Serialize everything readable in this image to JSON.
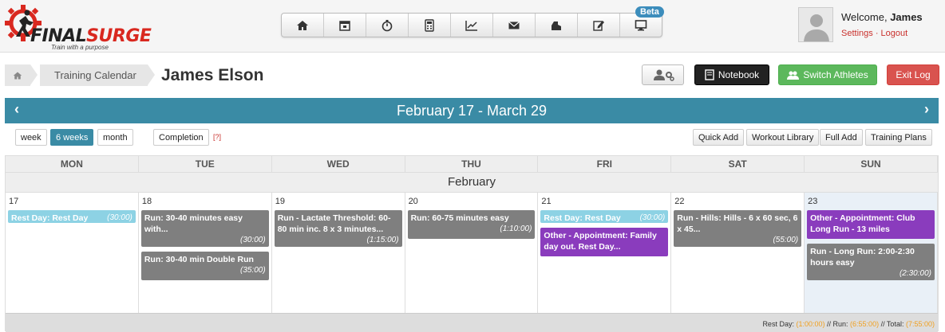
{
  "brand": {
    "logo_a": "FINAL",
    "logo_b": "SURGE",
    "tagline": "Train with a purpose"
  },
  "nav": {
    "items": [
      {
        "icon": "home-icon"
      },
      {
        "icon": "calendar-icon"
      },
      {
        "icon": "stopwatch-icon"
      },
      {
        "icon": "calculator-icon"
      },
      {
        "icon": "chart-icon"
      },
      {
        "icon": "mail-icon"
      },
      {
        "icon": "shoe-icon"
      },
      {
        "icon": "edit-icon"
      },
      {
        "icon": "monitor-icon"
      }
    ],
    "beta_badge": "Beta"
  },
  "user": {
    "welcome_prefix": "Welcome,",
    "name": "James",
    "settings": "Settings",
    "separator": "·",
    "logout": "Logout"
  },
  "breadcrumb": {
    "calendar": "Training Calendar"
  },
  "page_title": "James Elson",
  "actions": {
    "notebook": "Notebook",
    "switch_athletes": "Switch Athletes",
    "exit_log": "Exit Log"
  },
  "calendar": {
    "range": "February 17 - March 29",
    "prev": "‹",
    "next": "›",
    "views": {
      "week": "week",
      "six_weeks": "6 weeks",
      "month": "month"
    },
    "completion": "Completion",
    "help": "[?]",
    "tools": {
      "quick_add": "Quick Add",
      "workout_library": "Workout Library",
      "full_add": "Full Add",
      "training_plans": "Training Plans"
    },
    "day_headers": [
      "MON",
      "TUE",
      "WED",
      "THU",
      "FRI",
      "SAT",
      "SUN"
    ],
    "month_label": "February",
    "days": [
      {
        "num": "17",
        "events": [
          {
            "type": "rest",
            "title": "Rest Day: Rest Day",
            "duration": "(30:00)"
          }
        ]
      },
      {
        "num": "18",
        "events": [
          {
            "type": "run",
            "title": "Run: 30-40 minutes easy with...",
            "duration": "(30:00)"
          },
          {
            "type": "run",
            "title": "Run: 30-40 min Double Run",
            "duration": "(35:00)"
          }
        ]
      },
      {
        "num": "19",
        "events": [
          {
            "type": "run",
            "title": "Run - Lactate Threshold: 60-80 min inc. 8 x 3 minutes...",
            "duration": "(1:15:00)"
          }
        ]
      },
      {
        "num": "20",
        "events": [
          {
            "type": "run",
            "title": "Run: 60-75 minutes easy",
            "duration": "(1:10:00)"
          }
        ]
      },
      {
        "num": "21",
        "events": [
          {
            "type": "rest",
            "title": "Rest Day: Rest Day",
            "duration": "(30:00)"
          },
          {
            "type": "other",
            "title": "Other - Appointment: Family day out. Rest Day...",
            "duration": ""
          }
        ]
      },
      {
        "num": "22",
        "events": [
          {
            "type": "run",
            "title": "Run - Hills: Hills - 6 x 60 sec, 6 x 45...",
            "duration": "(55:00)"
          }
        ]
      },
      {
        "num": "23",
        "events": [
          {
            "type": "other",
            "title": "Other - Appointment: Club Long Run - 13 miles",
            "duration": ""
          },
          {
            "type": "run",
            "title": "Run - Long Run: 2:00-2:30 hours easy",
            "duration": "(2:30:00)"
          }
        ]
      }
    ],
    "totals": {
      "rest_label": "Rest Day:",
      "rest": "(1:00:00)",
      "run_label": "// Run:",
      "run": "(6:55:00)",
      "total_label": "// Total:",
      "total": "(7:55:00)"
    }
  },
  "colors": {
    "accent": "#3a8ba5",
    "rest": "#8dd2e4",
    "run": "#7f7f7f",
    "other": "#8a3cbd",
    "success": "#5cb85c",
    "danger": "#d9534f"
  }
}
